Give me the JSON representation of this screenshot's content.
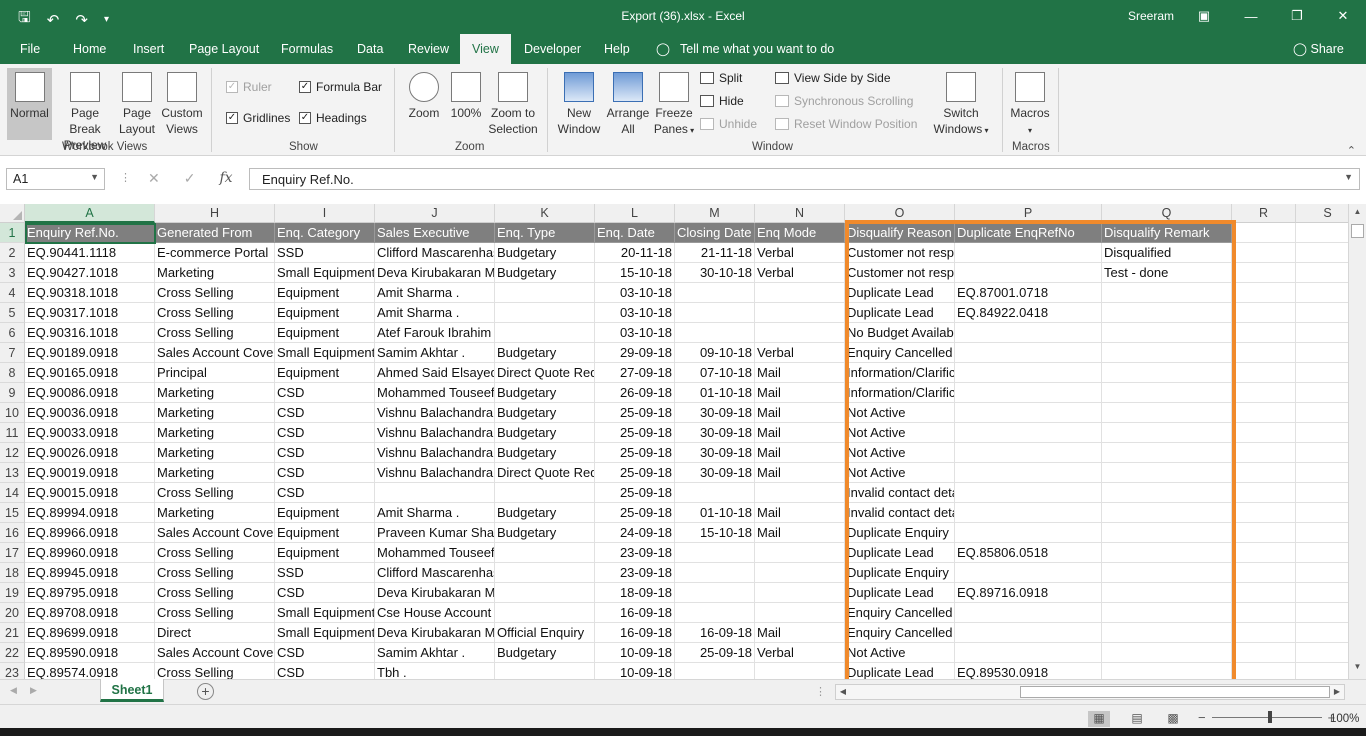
{
  "window": {
    "title": "Export (36).xlsx  -  Excel",
    "user": "Sreeram",
    "qat_icons": [
      "save-icon",
      "undo-icon",
      "redo-icon",
      "customize-icon"
    ]
  },
  "menu_tabs": [
    "File",
    "Home",
    "Insert",
    "Page Layout",
    "Formulas",
    "Data",
    "Review",
    "View",
    "Developer",
    "Help"
  ],
  "active_tab": "View",
  "tell_me": "Tell me what you want to do",
  "share": "Share",
  "ribbon": {
    "workbook_views": {
      "label": "Workbook Views",
      "normal": "Normal",
      "page_break_1": "Page Break",
      "page_break_2": "Preview",
      "page_layout_1": "Page",
      "page_layout_2": "Layout",
      "custom_views_1": "Custom",
      "custom_views_2": "Views"
    },
    "show": {
      "label": "Show",
      "ruler": "Ruler",
      "formula_bar": "Formula Bar",
      "gridlines": "Gridlines",
      "headings": "Headings"
    },
    "zoom": {
      "label": "Zoom",
      "zoom": "Zoom",
      "hundred": "100%",
      "zoom_sel_1": "Zoom to",
      "zoom_sel_2": "Selection"
    },
    "window": {
      "label": "Window",
      "new_1": "New",
      "new_2": "Window",
      "arrange_1": "Arrange",
      "arrange_2": "All",
      "freeze_1": "Freeze",
      "freeze_2": "Panes",
      "split": "Split",
      "hide": "Hide",
      "unhide": "Unhide",
      "view_side": "View Side by Side",
      "sync_scroll": "Synchronous Scrolling",
      "reset_pos": "Reset Window Position",
      "switch_1": "Switch",
      "switch_2": "Windows"
    },
    "macros": {
      "label": "Macros",
      "macros": "Macros"
    }
  },
  "formula_bar": {
    "name_box": "A1",
    "content": "Enquiry Ref.No."
  },
  "columns": [
    "A",
    "H",
    "I",
    "J",
    "K",
    "L",
    "M",
    "N",
    "O",
    "P",
    "Q",
    "R",
    "S"
  ],
  "rows": [
    [
      "1",
      "Enquiry Ref.No.",
      "Generated From",
      "Enq. Category",
      "Sales Executive",
      "Enq. Type",
      "Enq. Date",
      "Closing Date",
      "Enq Mode",
      "Disqualify Reason",
      "Duplicate EnqRefNo",
      "Disqualify Remark",
      "",
      ""
    ],
    [
      "2",
      "EQ.90441.1118",
      "E-commerce Portal",
      "SSD",
      "Clifford Mascarenhas .",
      "Budgetary",
      "20-11-18",
      "21-11-18",
      "Verbal",
      "Customer not responding",
      "",
      "Disqualified",
      "",
      ""
    ],
    [
      "3",
      "EQ.90427.1018",
      "Marketing",
      "Small Equipment",
      "Deva Kirubakaran M",
      "Budgetary",
      "15-10-18",
      "30-10-18",
      "Verbal",
      "Customer not responding",
      "",
      "Test - done",
      "",
      ""
    ],
    [
      "4",
      "EQ.90318.1018",
      "Cross Selling",
      "Equipment",
      "Amit Sharma .",
      "",
      "03-10-18",
      "",
      "",
      "Duplicate Lead",
      "EQ.87001.0718",
      "",
      "",
      ""
    ],
    [
      "5",
      "EQ.90317.1018",
      "Cross Selling",
      "Equipment",
      "Amit Sharma .",
      "",
      "03-10-18",
      "",
      "",
      "Duplicate Lead",
      "EQ.84922.0418",
      "",
      "",
      ""
    ],
    [
      "6",
      "EQ.90316.1018",
      "Cross Selling",
      "Equipment",
      "Atef Farouk Ibrahim Abddelwahab .",
      "",
      "03-10-18",
      "",
      "",
      "No Budget Available",
      "",
      "",
      "",
      ""
    ],
    [
      "7",
      "EQ.90189.0918",
      "Sales Account Coverage",
      "Small Equipment",
      "Samim Akhtar .",
      "Budgetary",
      "29-09-18",
      "09-10-18",
      "Verbal",
      "Enquiry Cancelled",
      "",
      "",
      "",
      ""
    ],
    [
      "8",
      "EQ.90165.0918",
      "Principal",
      "Equipment",
      "Ahmed Said Elsayed",
      "Direct Quote Request",
      "27-09-18",
      "07-10-18",
      "Mail",
      "Information/Clarification",
      "",
      "",
      "",
      ""
    ],
    [
      "9",
      "EQ.90086.0918",
      "Marketing",
      "CSD",
      "Mohammed Touseef",
      "Budgetary",
      "26-09-18",
      "01-10-18",
      "Mail",
      "Information/Clarification",
      "",
      "",
      "",
      ""
    ],
    [
      "10",
      "EQ.90036.0918",
      "Marketing",
      "CSD",
      "Vishnu Balachandran",
      "Budgetary",
      "25-09-18",
      "30-09-18",
      "Mail",
      "Not Active",
      "",
      "",
      "",
      ""
    ],
    [
      "11",
      "EQ.90033.0918",
      "Marketing",
      "CSD",
      "Vishnu Balachandran",
      "Budgetary",
      "25-09-18",
      "30-09-18",
      "Mail",
      "Not Active",
      "",
      "",
      "",
      ""
    ],
    [
      "12",
      "EQ.90026.0918",
      "Marketing",
      "CSD",
      "Vishnu Balachandran",
      "Budgetary",
      "25-09-18",
      "30-09-18",
      "Mail",
      "Not Active",
      "",
      "",
      "",
      ""
    ],
    [
      "13",
      "EQ.90019.0918",
      "Marketing",
      "CSD",
      "Vishnu Balachandran",
      "Direct Quote Request",
      "25-09-18",
      "30-09-18",
      "Mail",
      "Not Active",
      "",
      "",
      "",
      ""
    ],
    [
      "14",
      "EQ.90015.0918",
      "Cross Selling",
      "CSD",
      "",
      "",
      "25-09-18",
      "",
      "",
      "Invalid contact details",
      "",
      "",
      "",
      ""
    ],
    [
      "15",
      "EQ.89994.0918",
      "Marketing",
      "Equipment",
      "Amit Sharma .",
      "Budgetary",
      "25-09-18",
      "01-10-18",
      "Mail",
      "Invalid contact details",
      "",
      "",
      "",
      ""
    ],
    [
      "16",
      "EQ.89966.0918",
      "Sales Account Coverage",
      "Equipment",
      "Praveen Kumar Sha",
      "Budgetary",
      "24-09-18",
      "15-10-18",
      "Mail",
      "Duplicate Enquiry",
      "",
      "",
      "",
      ""
    ],
    [
      "17",
      "EQ.89960.0918",
      "Cross Selling",
      "Equipment",
      "Mohammed Touseef Kolkar Moham",
      "",
      "23-09-18",
      "",
      "",
      "Duplicate Lead",
      "EQ.85806.0518",
      "",
      "",
      ""
    ],
    [
      "18",
      "EQ.89945.0918",
      "Cross Selling",
      "SSD",
      "Clifford Mascarenhas .",
      "",
      "23-09-18",
      "",
      "",
      "Duplicate Enquiry",
      "",
      "",
      "",
      ""
    ],
    [
      "19",
      "EQ.89795.0918",
      "Cross Selling",
      "CSD",
      "Deva Kirubakaran Martin Jeyakumar",
      "",
      "18-09-18",
      "",
      "",
      "Duplicate Lead",
      "EQ.89716.0918",
      "",
      "",
      ""
    ],
    [
      "20",
      "EQ.89708.0918",
      "Cross Selling",
      "Small Equipment",
      "Cse House Account .",
      "",
      "16-09-18",
      "",
      "",
      "Enquiry Cancelled",
      "",
      "",
      "",
      ""
    ],
    [
      "21",
      "EQ.89699.0918",
      "Direct",
      "Small Equipment",
      "Deva Kirubakaran M",
      "Official Enquiry",
      "16-09-18",
      "16-09-18",
      "Mail",
      "Enquiry Cancelled",
      "",
      "",
      "",
      ""
    ],
    [
      "22",
      "EQ.89590.0918",
      "Sales Account Coverage",
      "CSD",
      "Samim Akhtar .",
      "Budgetary",
      "10-09-18",
      "25-09-18",
      "Verbal",
      "Not Active",
      "",
      "",
      "",
      ""
    ],
    [
      "23",
      "EQ.89574.0918",
      "Cross Selling",
      "CSD",
      "Tbh .",
      "",
      "10-09-18",
      "",
      "",
      "Duplicate Lead",
      "EQ.89530.0918",
      "",
      "",
      ""
    ]
  ],
  "sheet_tab": "Sheet1",
  "status": {
    "zoom": "100%"
  },
  "colors": {
    "excel_green": "#217346",
    "highlight_border": "#f08a2c",
    "header_fill": "#7f7f7f"
  }
}
